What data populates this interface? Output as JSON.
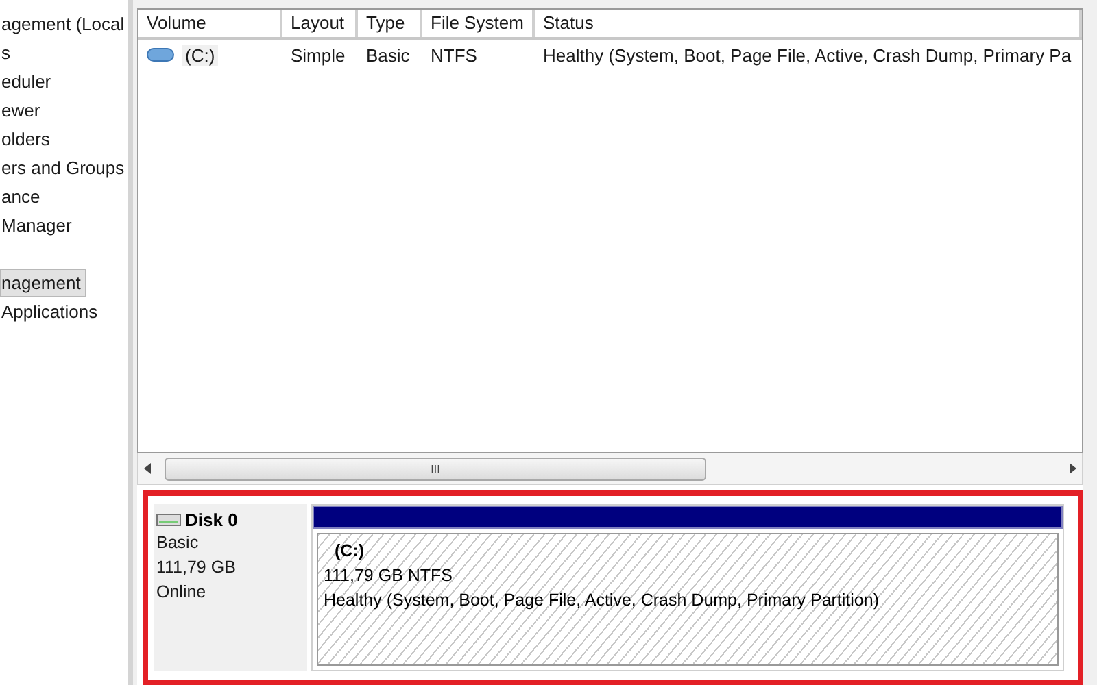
{
  "tree": {
    "groups": [
      {
        "items": [
          {
            "label": "agement (Local",
            "selected": false
          },
          {
            "label": "s",
            "selected": false
          },
          {
            "label": "eduler",
            "selected": false
          },
          {
            "label": "ewer",
            "selected": false
          },
          {
            "label": "olders",
            "selected": false
          },
          {
            "label": "ers and Groups",
            "selected": false
          },
          {
            "label": "ance",
            "selected": false
          },
          {
            "label": "Manager",
            "selected": false
          }
        ]
      },
      {
        "items": [
          {
            "label": "nagement",
            "selected": true
          },
          {
            "label": "Applications",
            "selected": false
          }
        ]
      }
    ]
  },
  "volume_list": {
    "columns": [
      "Volume",
      "Layout",
      "Type",
      "File System",
      "Status"
    ],
    "rows": [
      {
        "cells": [
          "(C:)",
          "Simple",
          "Basic",
          "NTFS",
          "Healthy (System, Boot, Page File, Active, Crash Dump, Primary Pa"
        ]
      }
    ]
  },
  "horizontal_scrollbar": {
    "grip": "III"
  },
  "disk": {
    "highlighted": true,
    "name": "Disk 0",
    "type": "Basic",
    "size": "111,79 GB",
    "state": "Online",
    "partition": {
      "name": "(C:)",
      "size": "111,79 GB NTFS",
      "status": "Healthy (System, Boot, Page File, Active, Crash Dump, Primary Partition)"
    }
  }
}
